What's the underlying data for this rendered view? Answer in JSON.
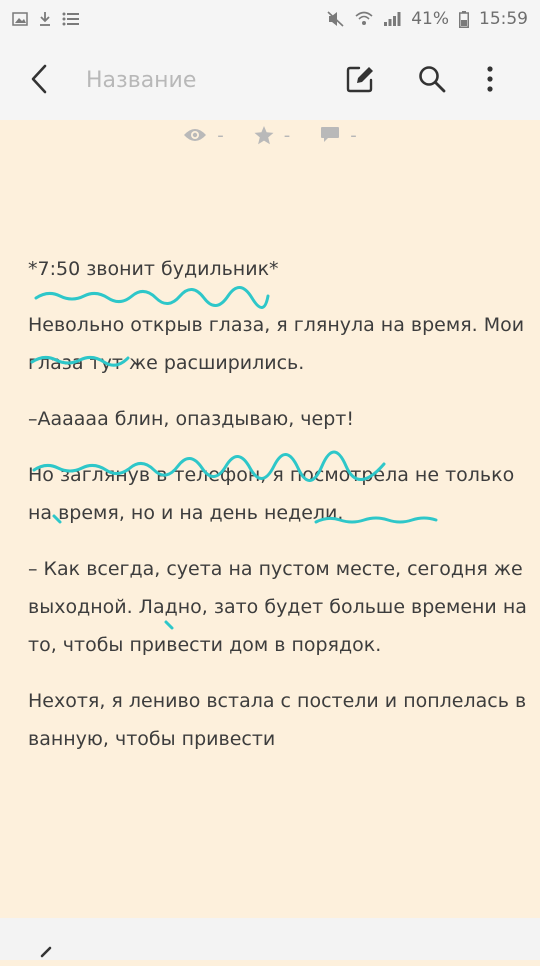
{
  "status_bar": {
    "battery": "41%",
    "time": "15:59"
  },
  "toolbar": {
    "title_placeholder": "Название"
  },
  "stats": {
    "views": "-",
    "votes": "-",
    "comments": "-"
  },
  "content": {
    "paragraphs": [
      "*7:50 звонит будильник*",
      "Невольно открыв глаза, я глянула на время. Мои глаза тут же расширились.",
      "–Аааааа блин, опаздываю, черт!",
      "Но заглянув в телефон, я посмотрела не только на время, но и на день недели.",
      "– Как всегда, суета на пустом месте, сегодня же выходной. Ладно, зато будет больше времени на то, чтобы привести дом в порядок.",
      "Нехотя, я лениво встала с постели и поплелась в ванную, чтобы привести"
    ]
  },
  "colors": {
    "accent_underline": "#2ec7c9",
    "page_background": "#fdf0dc"
  }
}
